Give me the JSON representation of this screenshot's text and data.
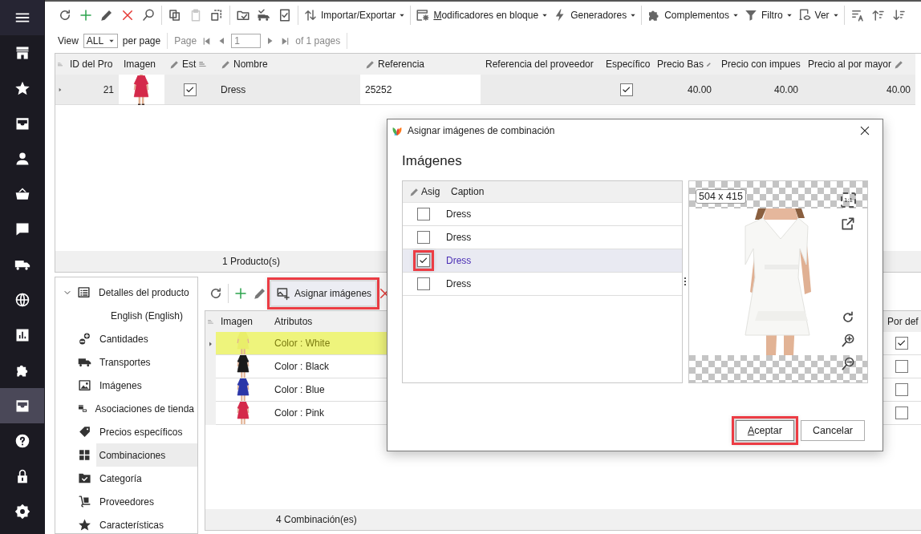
{
  "nav": [
    {
      "selected": false
    },
    {
      "selected": false
    },
    {
      "selected": false
    },
    {
      "selected": false
    },
    {
      "selected": false
    },
    {
      "selected": false
    },
    {
      "selected": false
    },
    {
      "selected": false
    },
    {
      "selected": false
    },
    {
      "selected": false
    },
    {
      "selected": false
    },
    {
      "selected": true
    },
    {
      "selected": false
    },
    {
      "selected": false
    },
    {
      "selected": false
    }
  ],
  "toolbar": [
    {
      "kind": "icon",
      "disabled": false
    },
    {
      "kind": "icon",
      "disabled": false
    },
    {
      "kind": "icon",
      "disabled": false
    },
    {
      "kind": "icon",
      "disabled": false
    },
    {
      "kind": "icon",
      "disabled": false
    },
    {
      "kind": "separator"
    },
    {
      "kind": "icon",
      "disabled": false
    },
    {
      "kind": "icon",
      "disabled": true
    },
    {
      "kind": "icon",
      "disabled": false
    },
    {
      "kind": "separator"
    },
    {
      "kind": "icon",
      "disabled": false
    },
    {
      "kind": "icon",
      "disabled": false
    },
    {
      "kind": "icon",
      "disabled": false
    },
    {
      "kind": "separator"
    },
    {
      "kind": "menu",
      "label": "Importar/Exportar",
      "underline_first": false
    },
    {
      "kind": "separator"
    },
    {
      "kind": "menu",
      "label": "Modificadores en bloque",
      "underline_first": true
    },
    {
      "kind": "menu",
      "label": "Generadores",
      "underline_first": false
    },
    {
      "kind": "separator"
    },
    {
      "kind": "menu",
      "label": "Complementos",
      "underline_first": false
    },
    {
      "kind": "menu",
      "label": "Filtro",
      "underline_first": false
    },
    {
      "kind": "menu",
      "label": "Ver",
      "underline_first": false
    },
    {
      "kind": "separator"
    },
    {
      "kind": "icon",
      "disabled": false
    },
    {
      "kind": "icon",
      "disabled": false
    },
    {
      "kind": "icon",
      "disabled": false
    }
  ],
  "pager": {
    "view_label": "View",
    "view_value": "ALL",
    "per_page": "per page",
    "page_label": "Page",
    "page_value": "1",
    "of_pages": "of 1 pages"
  },
  "products": {
    "columns": [
      {
        "label": "ID del Pro",
        "editable": false
      },
      {
        "label": "Imagen",
        "editable": false
      },
      {
        "label": "Est",
        "editable": true,
        "sorted": true
      },
      {
        "label": "Nombre",
        "editable": true
      },
      {
        "label": "Referencia",
        "editable": true
      },
      {
        "label": "Referencia del proveedor",
        "editable": false
      },
      {
        "label": "Específico",
        "editable": false
      },
      {
        "label": "Precio Bas",
        "editable": true,
        "pencil_after": true
      },
      {
        "label": "Precio con impues",
        "editable": false
      },
      {
        "label": "Precio al por mayor",
        "editable": true,
        "pencil_after": true
      }
    ],
    "rows": [
      {
        "selected": true,
        "id": "21",
        "status": true,
        "name": "Dress",
        "reference": "25252",
        "specific": true,
        "base_price": "40.00",
        "price_tax": "40.00",
        "wholesale_price": "40.00"
      }
    ],
    "footer": "1 Producto(s)"
  },
  "tree": [
    {
      "label": "Detalles del producto",
      "expanded": true,
      "selected": false,
      "children": [
        {
          "label": "English (English)",
          "selected": false
        }
      ]
    },
    {
      "label": "Cantidades",
      "selected": false
    },
    {
      "label": "Transportes",
      "selected": false
    },
    {
      "label": "Imágenes",
      "selected": false
    },
    {
      "label": "Asociaciones de tienda",
      "selected": false
    },
    {
      "label": "Precios específicos",
      "selected": false
    },
    {
      "label": "Combinaciones",
      "selected": true
    },
    {
      "label": "Categoría",
      "selected": false
    },
    {
      "label": "Proveedores",
      "selected": false
    },
    {
      "label": "Características",
      "selected": false
    }
  ],
  "combinations": {
    "assign_button": {
      "label": "Asignar imágenes",
      "highlighted": true
    },
    "columns": [
      "Imagen",
      "Atributos",
      "Por def"
    ],
    "rows": [
      {
        "attributes": "Color : White",
        "selected": true,
        "default": true
      },
      {
        "attributes": "Color : Black",
        "selected": false,
        "default": false
      },
      {
        "attributes": "Color : Blue",
        "selected": false,
        "default": false
      },
      {
        "attributes": "Color : Pink",
        "selected": false,
        "default": false
      }
    ],
    "footer": "4 Combinación(es)"
  },
  "dialog": {
    "title": "Asignar imágenes de combinación",
    "heading": "Imágenes",
    "columns": [
      "Asig",
      "Caption"
    ],
    "rows": [
      {
        "caption": "Dress",
        "checked": false,
        "selected": false,
        "highlighted": false
      },
      {
        "caption": "Dress",
        "checked": false,
        "selected": false,
        "highlighted": false
      },
      {
        "caption": "Dress",
        "checked": true,
        "selected": true,
        "highlighted": true
      },
      {
        "caption": "Dress",
        "checked": false,
        "selected": false,
        "highlighted": false
      }
    ],
    "image_size": "504 x 415",
    "actual_size": "1:1",
    "buttons": [
      {
        "label": "Aceptar",
        "underline_first": true,
        "highlighted": true
      },
      {
        "label": "Cancelar",
        "underline_first": false,
        "highlighted": false
      }
    ]
  }
}
